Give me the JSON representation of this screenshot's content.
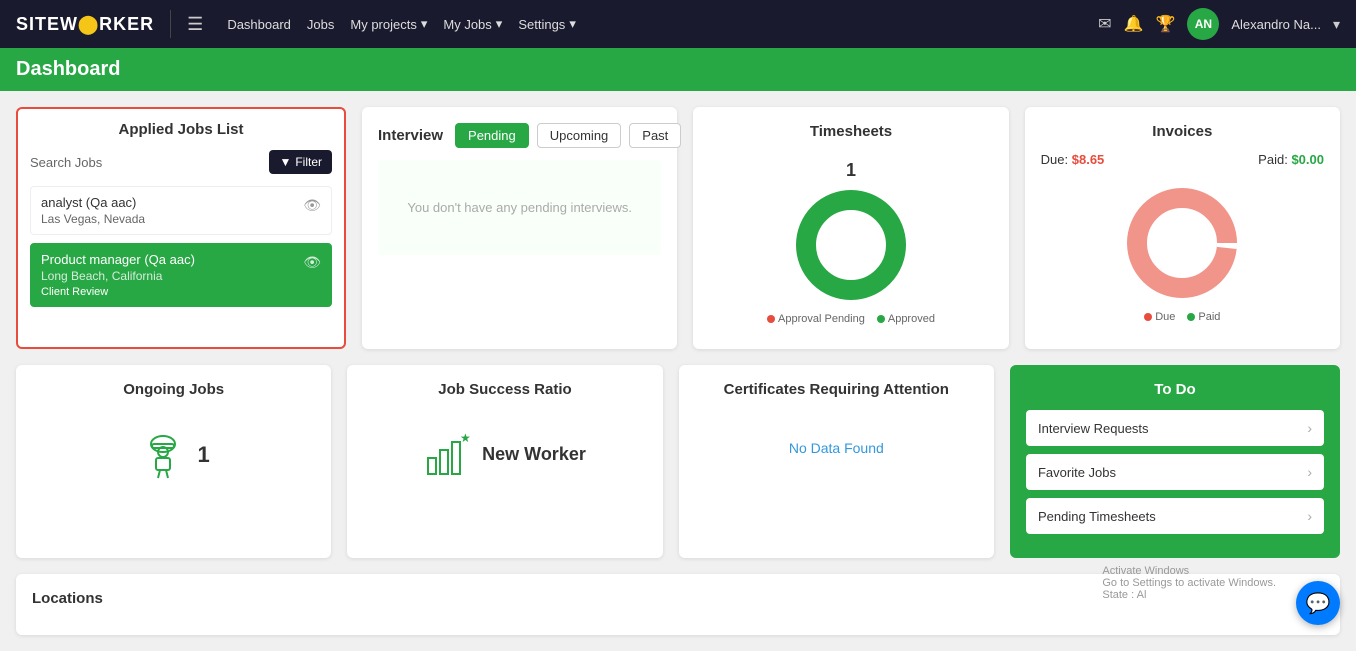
{
  "navbar": {
    "brand": "SITEW",
    "brand_highlight": "O",
    "brand_rest": "RKER",
    "links": [
      {
        "label": "Dashboard",
        "id": "dashboard"
      },
      {
        "label": "Jobs",
        "id": "jobs"
      },
      {
        "label": "My projects",
        "id": "myprojects",
        "dropdown": true
      },
      {
        "label": "My Jobs",
        "id": "myjobs",
        "dropdown": true
      },
      {
        "label": "Settings",
        "id": "settings",
        "dropdown": true
      }
    ],
    "username": "Alexandro Na...",
    "avatar_initials": "AN"
  },
  "page_header": {
    "title": "Dashboard"
  },
  "applied_jobs": {
    "title": "Applied Jobs List",
    "search_label": "Search Jobs",
    "filter_label": "Filter",
    "jobs": [
      {
        "title": "analyst (Qa aac)",
        "location": "Las Vegas, Nevada",
        "status": "",
        "active": false
      },
      {
        "title": "Product manager (Qa aac)",
        "location": "Long Beach, California",
        "status": "Client Review",
        "active": true
      }
    ]
  },
  "interview": {
    "label": "Interview",
    "tabs": [
      {
        "label": "Pending",
        "active": true
      },
      {
        "label": "Upcoming",
        "active": false
      },
      {
        "label": "Past",
        "active": false
      }
    ],
    "empty_message": "You don't have any pending interviews."
  },
  "timesheets": {
    "title": "Timesheets",
    "count": "1",
    "legend": [
      {
        "label": "Approval Pending",
        "color": "#e74c3c"
      },
      {
        "label": "Approved",
        "color": "#28a745"
      }
    ],
    "donut": {
      "approved_pct": 100,
      "pending_pct": 0
    }
  },
  "invoices": {
    "title": "Invoices",
    "due_label": "Due:",
    "due_amount": "$8.65",
    "paid_label": "Paid:",
    "paid_amount": "$0.00",
    "donut": {
      "due_pct": 100,
      "paid_pct": 0
    }
  },
  "ongoing_jobs": {
    "title": "Ongoing Jobs",
    "count": "1"
  },
  "job_success": {
    "title": "Job Success Ratio",
    "label": "New Worker"
  },
  "certificates": {
    "title": "Certificates Requiring Attention",
    "no_data": "No Data Found"
  },
  "todo": {
    "title": "To Do",
    "items": [
      {
        "label": "Interview Requests"
      },
      {
        "label": "Favorite Jobs"
      },
      {
        "label": "Pending Timesheets"
      }
    ]
  },
  "locations": {
    "title": "Locations"
  },
  "activate_windows": {
    "line1": "Activate Windows",
    "line2": "Go to Settings to activate Windows.",
    "state_label": "State : Al"
  }
}
